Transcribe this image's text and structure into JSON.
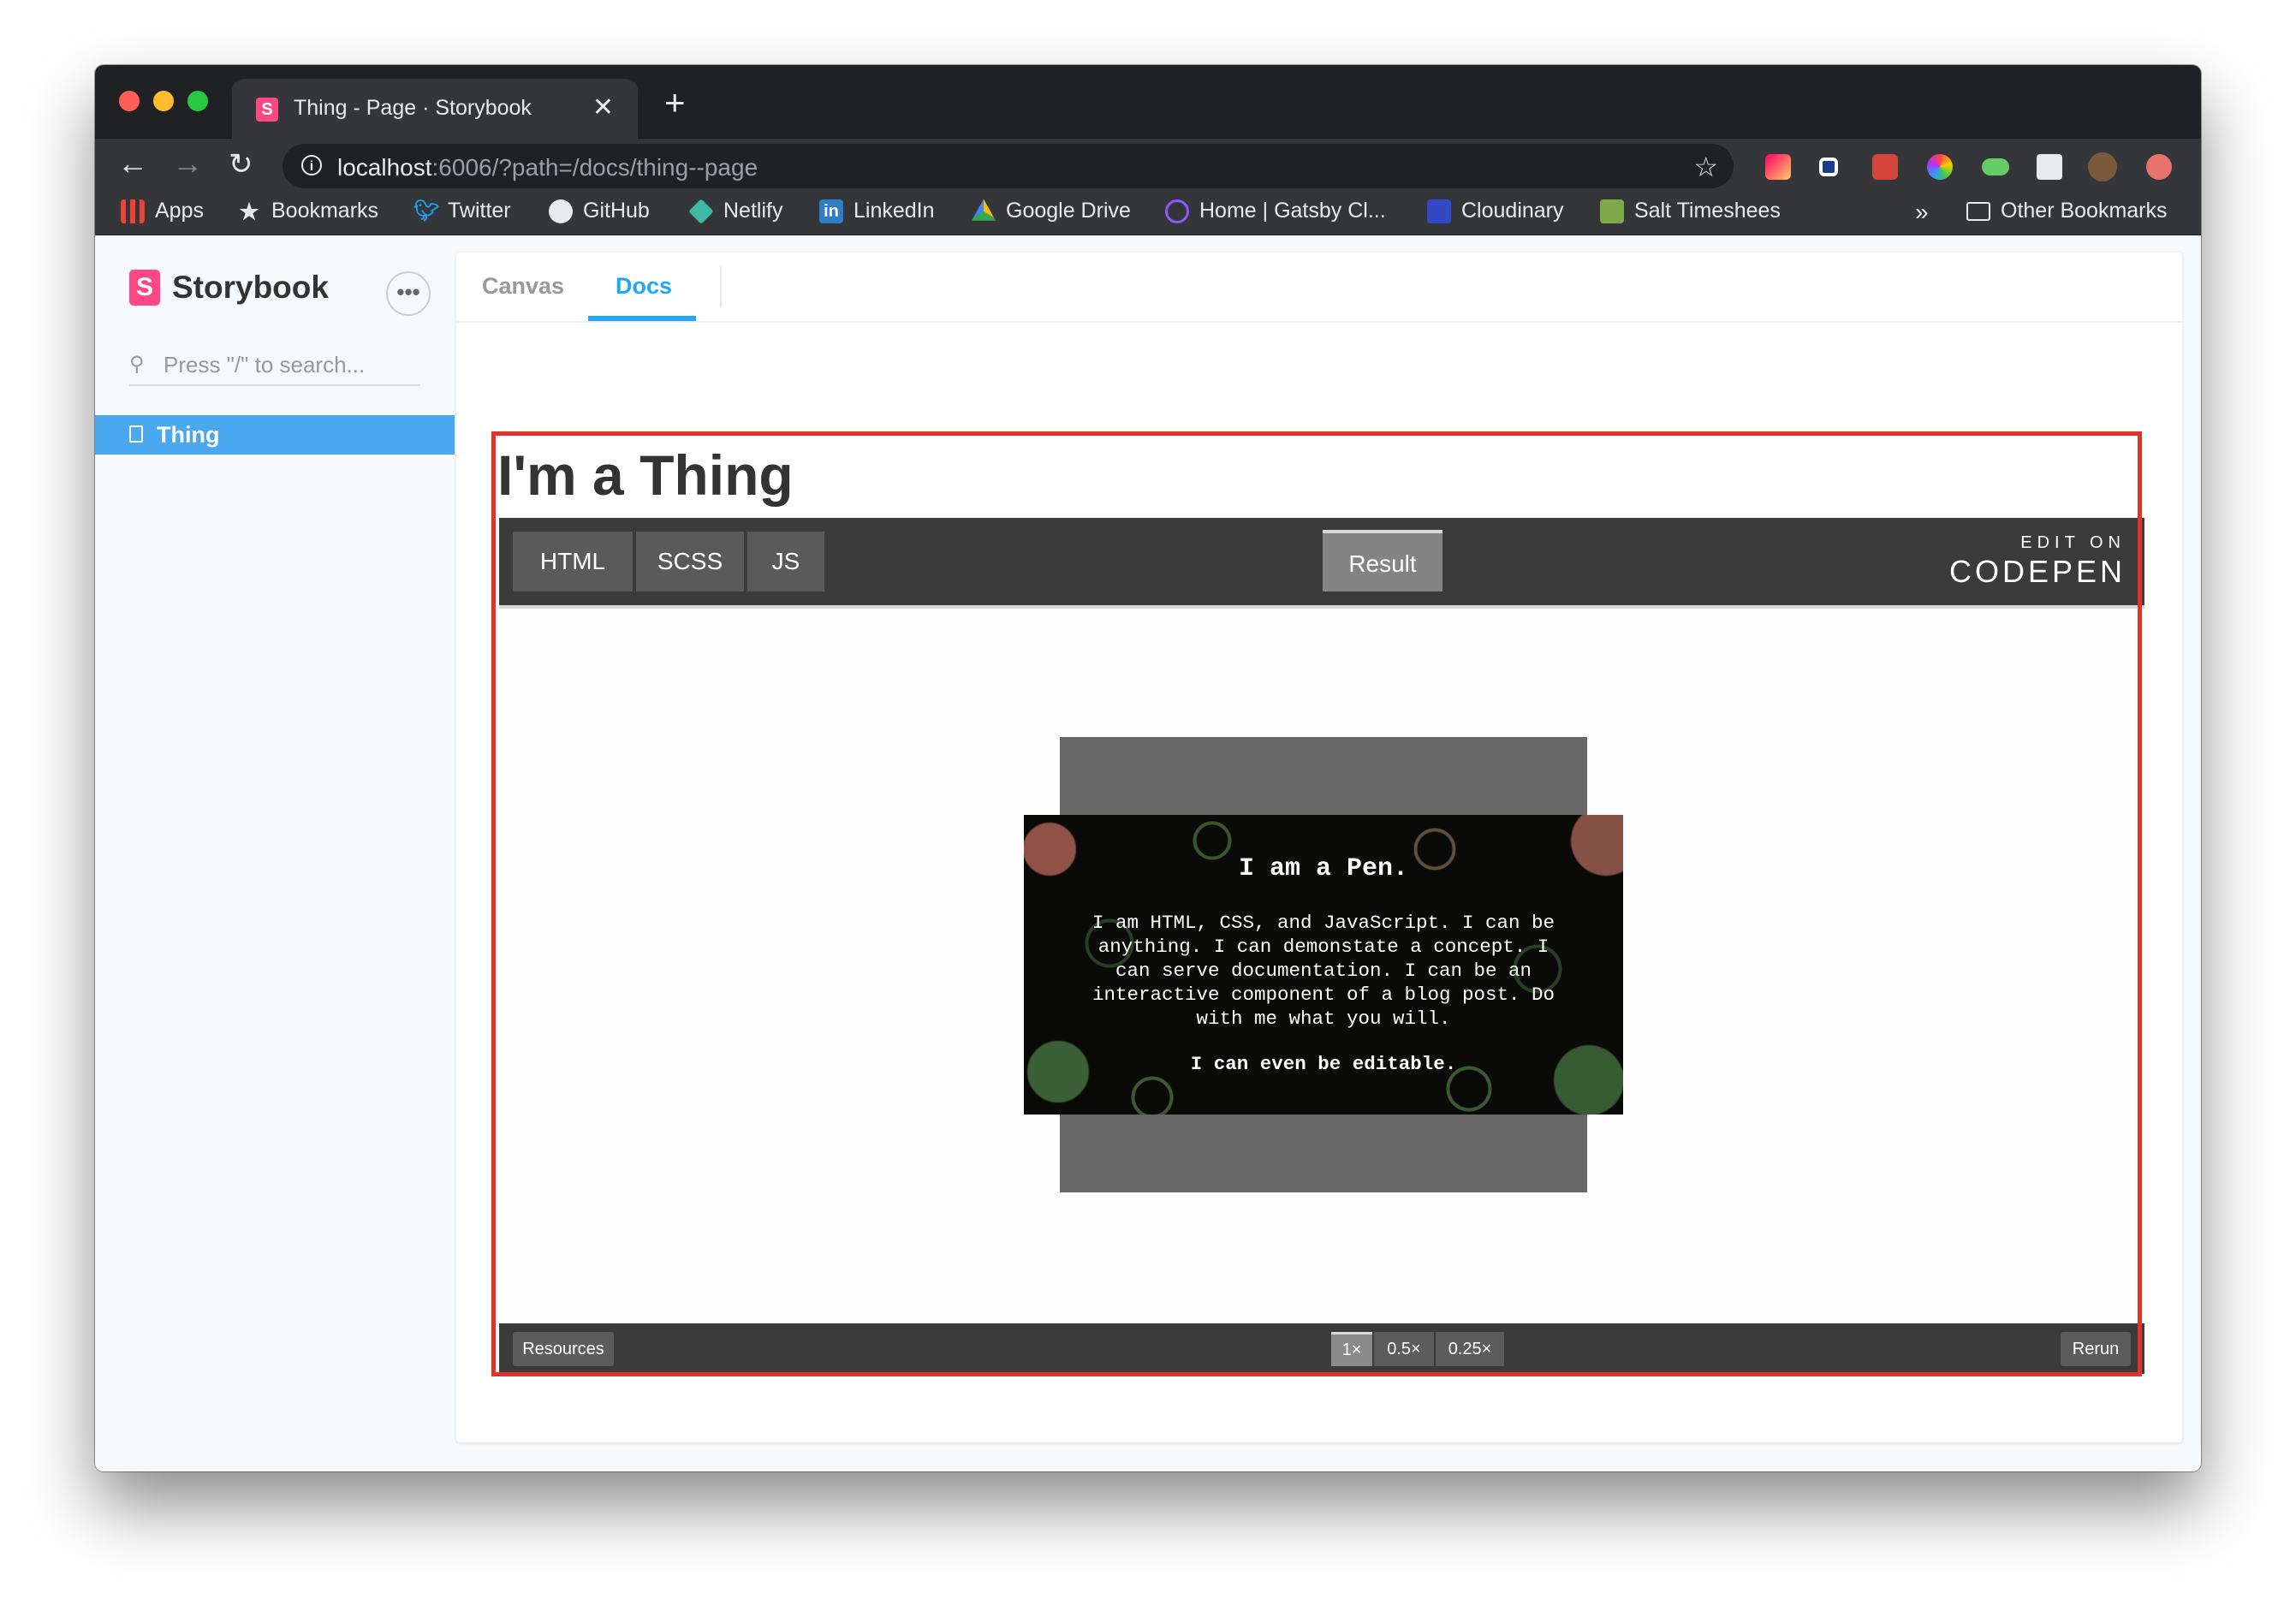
{
  "browser": {
    "tab_title": "Thing - Page · Storybook",
    "tab_favicon": "S",
    "close_glyph": "✕",
    "new_tab_glyph": "+",
    "url_host": "localhost",
    "url_path": ":6006/?path=/docs/thing--page",
    "bookmarks": [
      {
        "label": "Apps",
        "icon": "apps-grid-icon"
      },
      {
        "label": "Bookmarks",
        "icon": "star-icon"
      },
      {
        "label": "Twitter",
        "icon": "twitter-icon"
      },
      {
        "label": "GitHub",
        "icon": "github-icon"
      },
      {
        "label": "Netlify",
        "icon": "netlify-icon"
      },
      {
        "label": "LinkedIn",
        "icon": "linkedin-icon"
      },
      {
        "label": "Google Drive",
        "icon": "google-drive-icon"
      },
      {
        "label": "Home | Gatsby Cl...",
        "icon": "gatsby-icon"
      },
      {
        "label": "Cloudinary",
        "icon": "cloudinary-icon"
      },
      {
        "label": "Salt Timeshees",
        "icon": "salt-icon"
      }
    ],
    "overflow": "»",
    "other_bookmarks": "Other Bookmarks"
  },
  "storybook": {
    "brand": "Storybook",
    "brand_mark": "S",
    "menu_glyph": "•••",
    "search_placeholder": "Press \"/\" to search...",
    "tree_item": "Thing",
    "tabs": [
      "Canvas",
      "Docs"
    ],
    "active_tab": "Docs",
    "heading": "I'm a Thing"
  },
  "codepen": {
    "tabs": [
      "HTML",
      "SCSS",
      "JS"
    ],
    "result": "Result",
    "edit_on": "EDIT ON",
    "logo": "CODEPEN",
    "pen_title": "I am a Pen.",
    "pen_text": "I am HTML, CSS, and JavaScript. I can be anything. I can demonstate a concept. I can serve documentation. I can be an interactive component of a blog post. Do with me what you will.",
    "pen_editable": "I can even be editable.",
    "resources": "Resources",
    "zoom": [
      "1×",
      "0.5×",
      "0.25×"
    ],
    "active_zoom": "1×",
    "rerun": "Rerun"
  },
  "colors": {
    "storybook_pink": "#ff4785",
    "storybook_blue": "#1ea7fd",
    "highlight_red": "#e0342a"
  }
}
